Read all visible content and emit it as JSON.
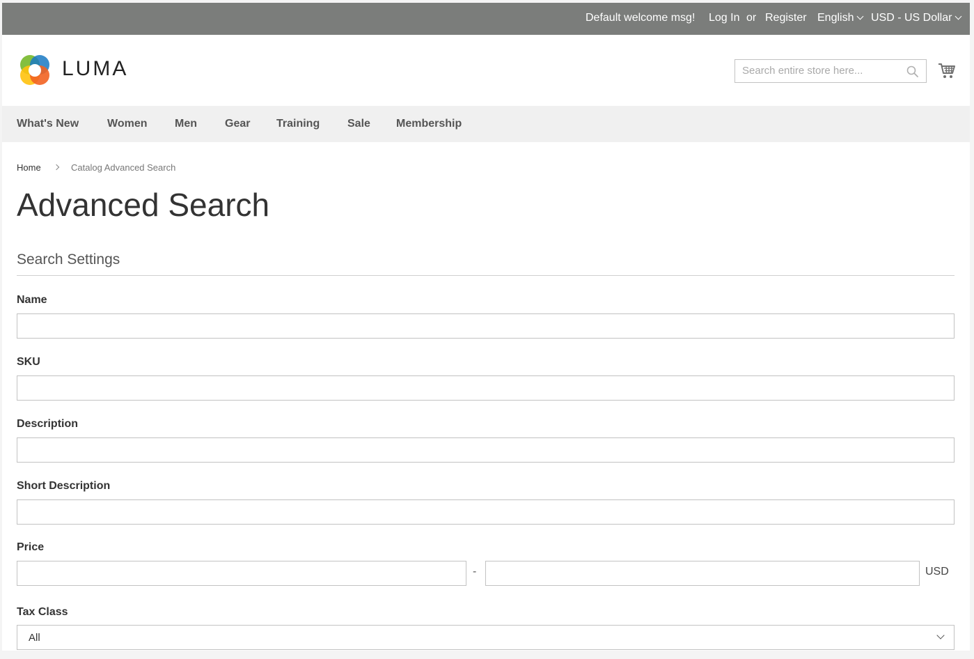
{
  "topbar": {
    "welcome": "Default welcome msg!",
    "login": "Log In",
    "or": "or",
    "register": "Register",
    "language": "English",
    "currency": "USD - US Dollar"
  },
  "header": {
    "logo_text": "LUMA",
    "search_placeholder": "Search entire store here...",
    "search_value": "",
    "icons": [
      "luma-logo-icon",
      "search-icon",
      "cart-icon"
    ]
  },
  "nav": {
    "items": [
      {
        "label": "What's New"
      },
      {
        "label": "Women"
      },
      {
        "label": "Men"
      },
      {
        "label": "Gear"
      },
      {
        "label": "Training"
      },
      {
        "label": "Sale"
      },
      {
        "label": "Membership"
      }
    ]
  },
  "breadcrumb": {
    "home": "Home",
    "current": "Catalog Advanced Search"
  },
  "page": {
    "title": "Advanced Search",
    "section_title": "Search Settings"
  },
  "form": {
    "name": {
      "label": "Name",
      "value": ""
    },
    "sku": {
      "label": "SKU",
      "value": ""
    },
    "description": {
      "label": "Description",
      "value": ""
    },
    "short_description": {
      "label": "Short Description",
      "value": ""
    },
    "price": {
      "label": "Price",
      "from": "",
      "to": "",
      "separator": "-",
      "currency": "USD"
    },
    "tax_class": {
      "label": "Tax Class",
      "selected": "All"
    }
  },
  "colors": {
    "topbar_bg": "#7b7d7b",
    "nav_bg": "#f0f0f0",
    "border": "#c2c2c2",
    "logo": [
      "#f26322",
      "#1979c3",
      "#77b82a",
      "#ffc20e"
    ]
  }
}
